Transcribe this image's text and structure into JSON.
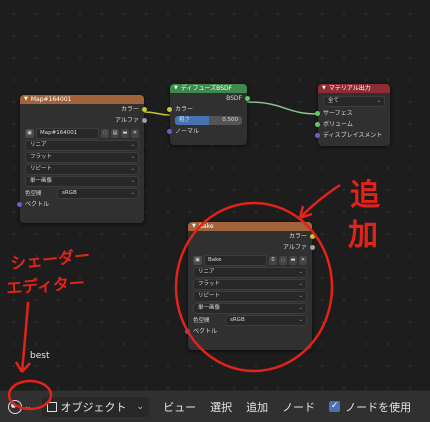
{
  "nodes": {
    "map": {
      "title": "Map#164001",
      "out_color": "カラー",
      "out_alpha": "アルファ",
      "image_name": "Map#164001",
      "interpolation": "リニア",
      "projection": "フラット",
      "extension": "リピート",
      "source": "単一画像",
      "colorspace_label": "色空間",
      "colorspace_value": "sRGB",
      "in_vector": "ベクトル"
    },
    "diffuse": {
      "title": "ディフューズBSDF",
      "out_bsdf": "BSDF",
      "in_color": "カラー",
      "roughness_label": "粗さ",
      "roughness_value": "0.500",
      "roughness_fraction": 0.5,
      "in_normal": "ノーマル"
    },
    "output": {
      "title": "マテリアル出力",
      "target": "全て",
      "in_surface": "サーフェス",
      "in_volume": "ボリューム",
      "in_displacement": "ディスプレイスメント"
    },
    "bake": {
      "title": "Bake",
      "out_color": "カラー",
      "out_alpha": "アルファ",
      "image_name": "Bake",
      "user_count": "0",
      "interpolation": "リニア",
      "projection": "フラット",
      "extension": "リピート",
      "source": "単一画像",
      "colorspace_label": "色空間",
      "colorspace_value": "sRGB",
      "in_vector": "ベクトル"
    }
  },
  "header_colors": {
    "texture": "#a3633a",
    "shader": "#3e8a4e",
    "output": "#8f2b33"
  },
  "annotations": {
    "left_line1": "シェーダー",
    "left_line2": "エディター",
    "right_line1": "追",
    "right_line2": "加",
    "color": "#e2231a"
  },
  "cursor_label": "best",
  "footer": {
    "editor_icon": "shader-editor-icon",
    "object_label": "オブジェクト",
    "view": "ビュー",
    "select": "選択",
    "add": "追加",
    "node": "ノード",
    "use_nodes": "ノードを使用"
  }
}
